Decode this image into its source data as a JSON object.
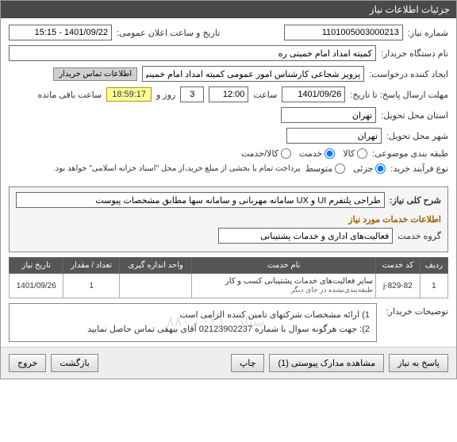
{
  "titlebar": "جزئیات اطلاعات نیاز",
  "fields": {
    "need_no_label": "شماره نیاز:",
    "need_no": "1101005003000213",
    "announce_dt_label": "تاریخ و ساعت اعلان عمومی:",
    "announce_dt": "1401/09/22 - 15:15",
    "device_name_label": "نام دستگاه خریدار:",
    "device_name": "کمیته امداد امام خمینی ره",
    "creator_label": "ایجاد کننده درخواست:",
    "creator": "پرویز شجاعی کارشناس امور عمومی کمیته امداد امام خمینی ره",
    "contact_btn": "اطلاعات تماس خریدار",
    "deadline_label": "مهلت ارسال پاسخ: تا تاریخ:",
    "deadline_date": "1401/09/26",
    "time_label": "ساعت",
    "deadline_time": "12:00",
    "days_remaining": "3",
    "days_label": "روز و",
    "countdown": "18:59:17",
    "remaining_suffix": "ساعت باقی مانده",
    "province_label": "استان محل تحویل:",
    "province": "تهران",
    "city_label": "شهر محل تحویل:",
    "city": "تهران",
    "class_label": "طبقه بندی موضوعی:",
    "r_goods": "کالا",
    "r_service": "خدمت",
    "r_both": "کالا/خدمت",
    "process_label": "نوع فرآیند خرید:",
    "r_partial": "جزئی",
    "r_medium": "متوسط",
    "process_note": "پرداخت تمام یا بخشی از مبلغ خرید،از محل \"اسناد خزانه اسلامی\" خواهد بود."
  },
  "inner": {
    "overview_label": "شرح کلی نیاز:",
    "overview": "طراحی پلتفرم UI و UX سامانه مهربانی و سامانه سها مطابق مشخصات پیوست",
    "services_header": "اطلاعات خدمات مورد نیاز",
    "group_label": "گروه خدمت",
    "group_value": "فعالیت‌های اداری و خدمات پشتیبانی"
  },
  "table": {
    "headers": [
      "ردیف",
      "کد خدمت",
      "نام خدمت",
      "واحد اندازه گیری",
      "تعداد / مقدار",
      "تاریخ نیاز"
    ],
    "row": {
      "idx": "1",
      "code": "829-82-j",
      "name_l1": "سایر فعالیت‌های خدمات پشتیبانی کسب و کار",
      "name_l2": "طبقه‌بندی‌نشده در جای دیگر",
      "unit": "",
      "qty": "1",
      "date": "1401/09/26"
    }
  },
  "notes": {
    "label": "توضیحات خریدار:",
    "line1": "1) ارائه مشخصات شرکتهای تامین کننده الزامی است",
    "line2": "2): جهت هرگونه سوال با شماره 02123902237 آقای بیهقی تماس حاصل نمایید"
  },
  "footer": {
    "reply": "پاسخ به نیاز",
    "attach": "مشاهده مدارک پیوستی (1)",
    "print": "چاپ",
    "back": "بازگشت",
    "exit": "خروج"
  },
  "watermark": "ستاد - ۰۲۱ - ۸۸۰"
}
